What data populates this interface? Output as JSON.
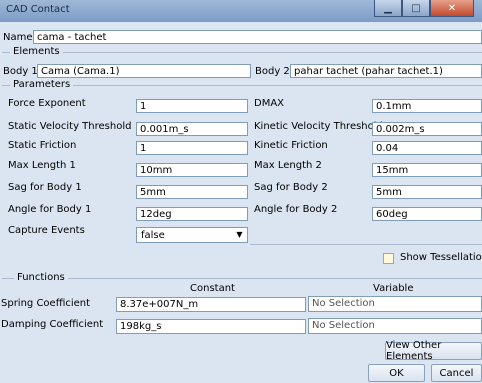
{
  "window": {
    "title": "CAD Contact"
  },
  "name_label": "Name",
  "name_value": "cama - tachet",
  "elements": {
    "section": "Elements",
    "body1_label": "Body 1",
    "body1_value": "Cama (Cama.1)",
    "body2_label": "Body 2",
    "body2_value": "pahar tachet (pahar tachet.1)"
  },
  "parameters": {
    "section": "Parameters",
    "force_exponent": {
      "label": "Force Exponent",
      "value": "1"
    },
    "dmax": {
      "label": "DMAX",
      "value": "0.1mm"
    },
    "static_velocity_threshold": {
      "label": "Static Velocity Threshold",
      "value": "0.001m_s"
    },
    "kinetic_velocity_threshold": {
      "label": "Kinetic Velocity Threshold",
      "value": "0.002m_s"
    },
    "static_friction": {
      "label": "Static Friction",
      "value": "1"
    },
    "kinetic_friction": {
      "label": "Kinetic Friction",
      "value": "0.04"
    },
    "max_length_1": {
      "label": "Max Length 1",
      "value": "10mm"
    },
    "max_length_2": {
      "label": "Max Length 2",
      "value": "15mm"
    },
    "sag_body_1": {
      "label": "Sag for Body 1",
      "value": "5mm"
    },
    "sag_body_2": {
      "label": "Sag for Body 2",
      "value": "5mm"
    },
    "angle_body_1": {
      "label": "Angle for Body 1",
      "value": "12deg"
    },
    "angle_body_2": {
      "label": "Angle for Body 2",
      "value": "60deg"
    },
    "capture_events": {
      "label": "Capture Events",
      "value": "false"
    }
  },
  "show_tessellation": {
    "label": "Show Tessellation",
    "checked": false
  },
  "functions": {
    "section": "Functions",
    "constant_header": "Constant",
    "variable_header": "Variable",
    "spring": {
      "label": "Spring Coefficient",
      "constant": "8.37e+007N_m",
      "variable": "No Selection"
    },
    "damping": {
      "label": "Damping Coefficient",
      "constant": "198kg_s",
      "variable": "No Selection"
    }
  },
  "buttons": {
    "view_other": "View Other Elements",
    "ok": "OK",
    "cancel": "Cancel"
  }
}
